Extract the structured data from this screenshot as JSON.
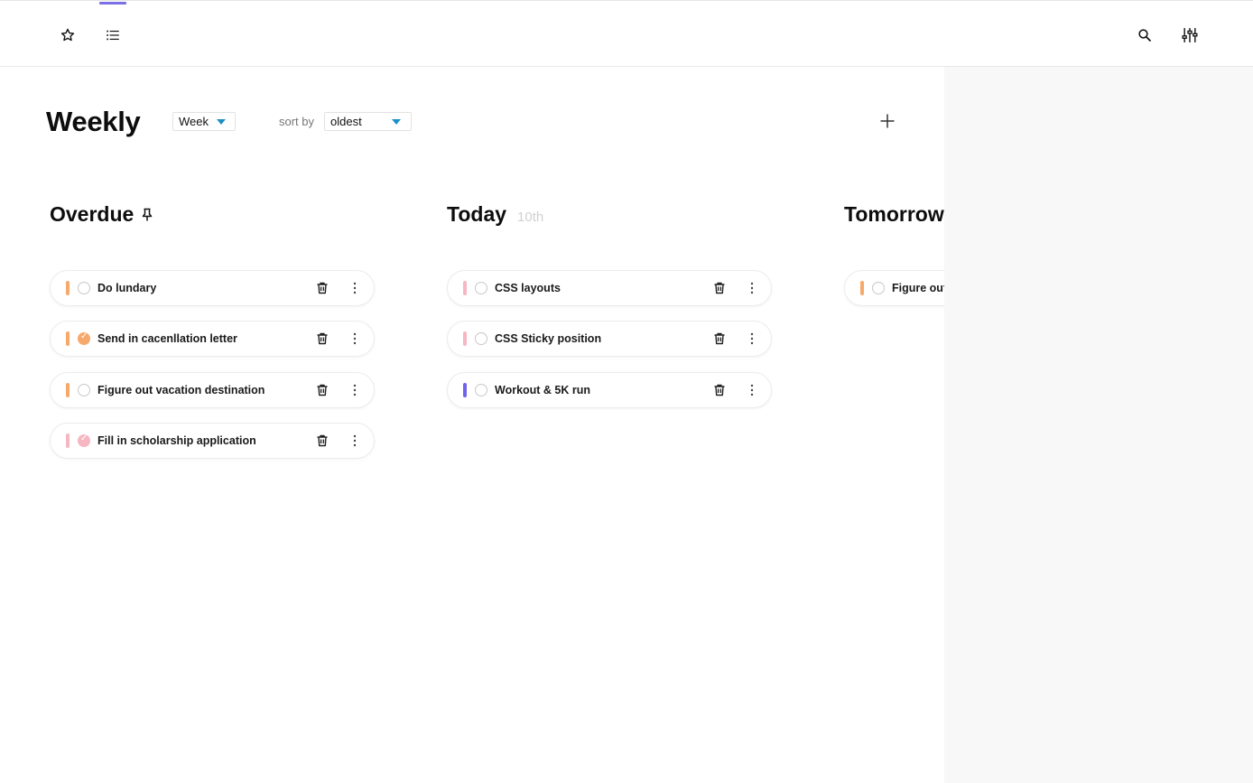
{
  "nav": {
    "icons": [
      "star-icon",
      "list-icon",
      "search-icon",
      "sliders-icon"
    ]
  },
  "header": {
    "title": "Weekly",
    "period": "Week",
    "sort_label": "sort by",
    "sort_value": "oldest"
  },
  "colors": {
    "accent": "#7b6fe6",
    "caret": "#1a8fc8",
    "orange": "#f7a96b",
    "pink": "#f6b7c2",
    "purple": "#7064e8"
  },
  "columns": [
    {
      "title": "Overdue",
      "date": "",
      "tasks": [
        {
          "label": "Do lundary",
          "priority": "orange",
          "done": false
        },
        {
          "label": "Send in cacenllation letter",
          "priority": "orange",
          "done": true
        },
        {
          "label": "Figure out vacation destination",
          "priority": "orange",
          "done": false
        },
        {
          "label": "Fill in scholarship application",
          "priority": "pink",
          "done": true
        }
      ]
    },
    {
      "title": "Today",
      "date": "10th",
      "tasks": [
        {
          "label": "CSS layouts",
          "priority": "pink",
          "done": false
        },
        {
          "label": "CSS Sticky position",
          "priority": "pink",
          "done": false
        },
        {
          "label": "Workout & 5K run",
          "priority": "purple",
          "done": false
        }
      ]
    },
    {
      "title": "Tomorrow",
      "date": "",
      "tasks": [
        {
          "label": "Figure out",
          "priority": "orange",
          "done": false
        }
      ]
    }
  ]
}
